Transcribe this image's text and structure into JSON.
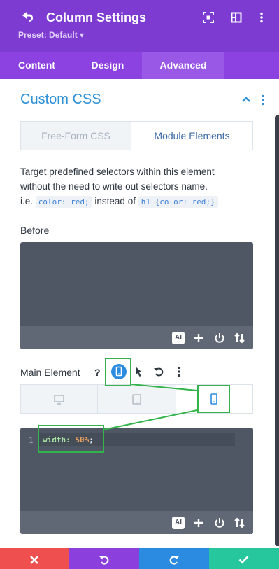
{
  "header": {
    "title": "Column Settings",
    "preset": "Preset: Default ▾"
  },
  "tabs": [
    {
      "label": "Content"
    },
    {
      "label": "Design"
    },
    {
      "label": "Advanced"
    }
  ],
  "section": {
    "title": "Custom CSS"
  },
  "subtabs": {
    "free_form": "Free-Form CSS",
    "module_elements": "Module Elements"
  },
  "description": {
    "line1": "Target predefined selectors within this element",
    "line2": "without the need to write out selectors name.",
    "prefix": "i.e.",
    "chip1": "color: red;",
    "middle": "instead of",
    "chip2": "h1 {color: red;}"
  },
  "before": {
    "label": "Before",
    "ai": "AI"
  },
  "main_element": {
    "label": "Main Element",
    "help": "?",
    "ai": "AI",
    "line_number": "1",
    "code_prop": "width:",
    "code_value": "50%",
    "code_semi": ";"
  },
  "colors": {
    "header": "#7d3bd1",
    "tabs": "#8c42e0",
    "active_tab": "#9a58e6",
    "accent_blue": "#2c8fd8",
    "editor_bg": "#4e5763",
    "highlight": "#32b44a",
    "cancel": "#ef4f4f",
    "undo": "#8b3fdc",
    "redo": "#2b8be0",
    "save": "#27c79e"
  },
  "icons": {
    "back": "back-arrow-icon",
    "fullscreen": "fullscreen-icon",
    "split": "split-view-icon",
    "more": "kebab-icon"
  }
}
